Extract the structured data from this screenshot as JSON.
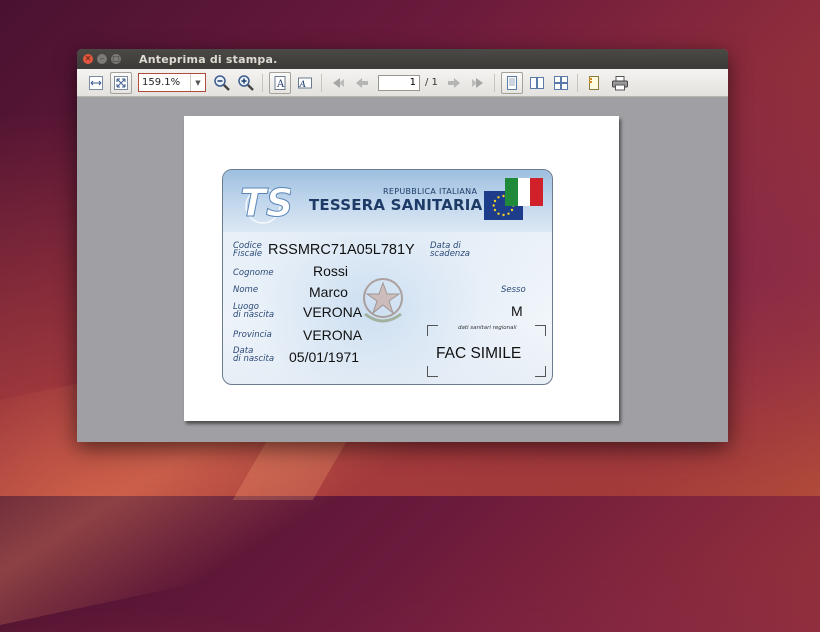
{
  "window": {
    "title": "Anteprima di stampa."
  },
  "toolbar": {
    "zoom_value": "159.1%",
    "page_current": "1",
    "page_total": "/ 1"
  },
  "card": {
    "republic": "REPUBBLICA ITALIANA",
    "title": "TESSERA SANITARIA",
    "logo_text": "TS",
    "codice_fiscale_label_1": "Codice",
    "codice_fiscale_label_2": "Fiscale",
    "codice_fiscale": "RSSMRC71A05L781Y",
    "scadenza_label_1": "Data di",
    "scadenza_label_2": "scadenza",
    "cognome_label": "Cognome",
    "cognome": "Rossi",
    "nome_label": "Nome",
    "nome": "Marco",
    "sesso_label": "Sesso",
    "sesso": "M",
    "luogo_label_1": "Luogo",
    "luogo_label_2": "di nascita",
    "luogo": "VERONA",
    "dati_sanitari": "dati sanitari regionali",
    "provincia_label": "Provincia",
    "provincia": "VERONA",
    "data_nascita_label_1": "Data",
    "data_nascita_label_2": "di nascita",
    "data_nascita": "05/01/1971",
    "fac_simile": "FAC SIMILE"
  },
  "colors": {
    "accent": "#b04a3a",
    "card_blue": "#1d3b66",
    "flag": [
      "#1e8a3a",
      "#ffffff",
      "#d0202a"
    ]
  }
}
